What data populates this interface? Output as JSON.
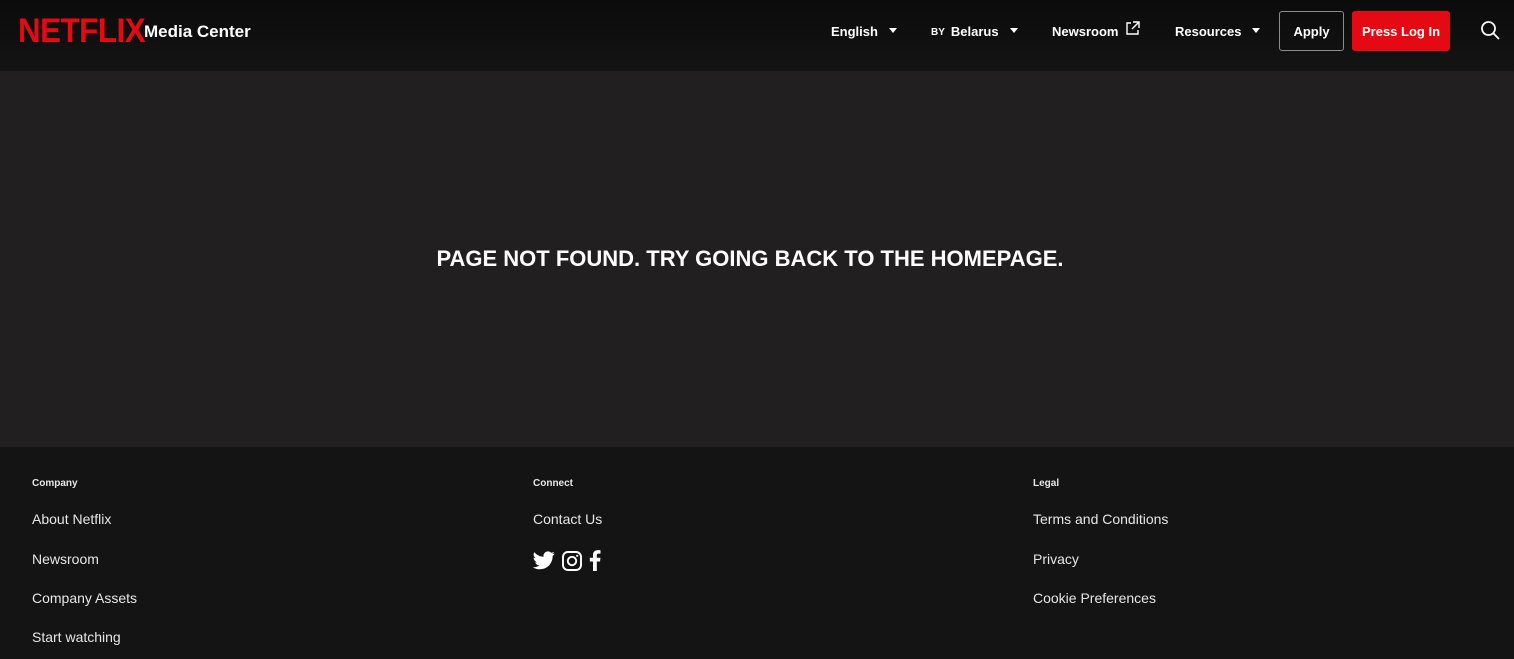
{
  "header": {
    "logo": "NETFLIX",
    "site_title": "Media Center",
    "language": "English",
    "region_flag": "BY",
    "region": "Belarus",
    "newsroom": "Newsroom",
    "resources": "Resources",
    "apply": "Apply",
    "press_login": "Press Log In"
  },
  "main": {
    "message": "PAGE NOT FOUND. TRY GOING BACK TO THE HOMEPAGE."
  },
  "footer": {
    "company": {
      "heading": "Company",
      "links": [
        "About Netflix",
        "Newsroom",
        "Company Assets",
        "Start watching"
      ]
    },
    "connect": {
      "heading": "Connect",
      "links": [
        "Contact Us"
      ],
      "social_icons": [
        "twitter-icon",
        "instagram-icon",
        "facebook-icon"
      ]
    },
    "legal": {
      "heading": "Legal",
      "links": [
        "Terms and Conditions",
        "Privacy",
        "Cookie Preferences"
      ]
    }
  },
  "colors": {
    "brand_red": "#e50914",
    "header_bg": "#141414",
    "main_bg": "#221f20",
    "footer_bg": "#141414"
  }
}
